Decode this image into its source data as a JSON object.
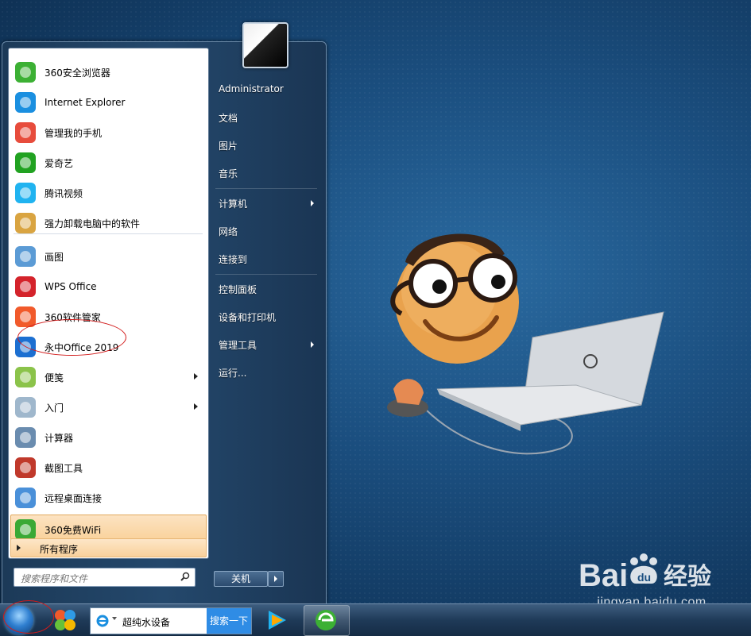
{
  "start_menu": {
    "programs": [
      {
        "label": "360安全浏览器",
        "icon": "360-browser-icon"
      },
      {
        "label": "Internet Explorer",
        "icon": "internet-explorer-icon"
      },
      {
        "label": "管理我的手机",
        "icon": "phone-manager-icon"
      },
      {
        "label": "爱奇艺",
        "icon": "iqiyi-icon"
      },
      {
        "label": "腾讯视频",
        "icon": "tencent-video-icon"
      },
      {
        "label": "强力卸载电脑中的软件",
        "icon": "uninstaller-icon"
      },
      {
        "label": "画图",
        "icon": "paint-icon"
      },
      {
        "label": "WPS Office",
        "icon": "wps-icon"
      },
      {
        "label": "360软件管家",
        "icon": "360-software-manager-icon"
      },
      {
        "label": "永中Office 2019",
        "icon": "yozo-office-icon"
      },
      {
        "label": "便笺",
        "icon": "sticky-notes-icon"
      },
      {
        "label": "入门",
        "icon": "getting-started-icon"
      },
      {
        "label": "计算器",
        "icon": "calculator-icon"
      },
      {
        "label": "截图工具",
        "icon": "snipping-tool-icon"
      },
      {
        "label": "远程桌面连接",
        "icon": "remote-desktop-icon"
      },
      {
        "label": "360免费WiFi",
        "icon": "wifi-icon"
      }
    ],
    "all_programs": "所有程序",
    "search_placeholder": "搜索程序和文件",
    "right_pane": {
      "user": "Administrator",
      "items": [
        "文档",
        "图片",
        "音乐",
        "计算机",
        "网络",
        "连接到",
        "控制面板",
        "设备和打印机",
        "管理工具",
        "运行..."
      ]
    },
    "shutdown": "关机"
  },
  "taskbar": {
    "search_text": "超纯水设备",
    "search_button": "搜索一下"
  },
  "watermark": {
    "brand": "Bai du 经验",
    "url": "jingyan.baidu.com"
  },
  "colors": {
    "highlight": "#f9cf95",
    "annotation": "#d21b1b",
    "desktop": "#1b4f80"
  }
}
